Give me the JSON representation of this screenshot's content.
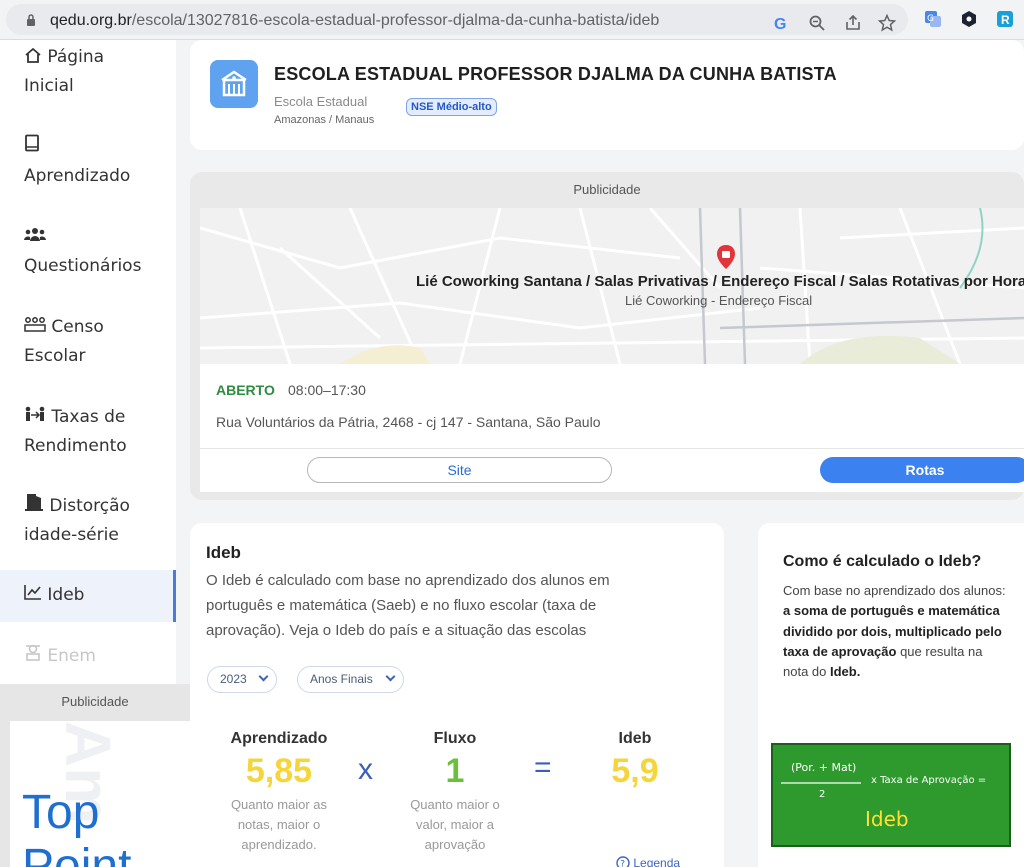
{
  "browser": {
    "url_domain": "qedu.org.br",
    "url_path": "/escola/13027816-escola-estadual-professor-djalma-da-cunha-batista/ideb"
  },
  "sidebar": {
    "items": [
      {
        "icon": "home-icon",
        "label1": "Página",
        "label2": "Inicial"
      },
      {
        "icon": "book-icon",
        "label1": "",
        "label2": " Aprendizado"
      },
      {
        "icon": "people-icon",
        "label1": "",
        "label2": "Questionários"
      },
      {
        "icon": "census-icon",
        "label1": "Censo",
        "label2": "Escolar"
      },
      {
        "icon": "rates-icon",
        "label1": "Taxas de",
        "label2": "Rendimento"
      },
      {
        "icon": "door-icon",
        "label1": "Distorção",
        "label2": "idade-série"
      },
      {
        "icon": "chart-icon",
        "label1": "Ideb",
        "label2": ""
      },
      {
        "icon": "graduation-icon",
        "label1": "Enem",
        "label2": ""
      }
    ],
    "ad_label": "Publicidade",
    "ad_text1": "Top",
    "ad_text2": "Point",
    "ad_ghost": "Am"
  },
  "school": {
    "name": "ESCOLA ESTADUAL PROFESSOR DJALMA DA CUNHA BATISTA",
    "type": "Escola Estadual",
    "location": "Amazonas / Manaus",
    "nse": "NSE Médio-alto"
  },
  "ad": {
    "label": "Publicidade",
    "place_name": "Lié Coworking Santana / Salas Privativas / Endereço Fiscal / Salas Rotativas por Hora",
    "place_sub": "Lié Coworking - Endereço Fiscal",
    "status": "ABERTO",
    "hours": "08:00–17:30",
    "address": "Rua Voluntários da Pátria, 2468 - cj 147 - Santana, São Paulo",
    "site_label": "Site",
    "routes_label": "Rotas"
  },
  "ideb": {
    "title": "Ideb",
    "description": "O Ideb é calculado com base no aprendizado dos alunos em português e matemática (Saeb) e no fluxo escolar (taxa de aprovação). Veja o Ideb do país e a situação das escolas",
    "year": "2023",
    "stage": "Anos Finais",
    "aprendizado_label": "Aprendizado",
    "aprendizado_value": "5,85",
    "aprendizado_note": "Quanto maior as notas, maior o aprendizado.",
    "times": "x",
    "fluxo_label": "Fluxo",
    "fluxo_value": "1",
    "fluxo_note": "Quanto maior o valor, maior a aprovação",
    "equals": "=",
    "ideb_label": "Ideb",
    "ideb_value": "5,9",
    "legend_link": "Legenda",
    "colors": {
      "aprendizado": "#f5d53a",
      "fluxo": "#6bbf3a",
      "ideb": "#f5d53a"
    }
  },
  "how": {
    "title": "Como é calculado o Ideb?",
    "text_plain1": "Com base no aprendizado dos alunos: ",
    "text_bold": "a soma de português e matemática dividido por dois, multiplicado pelo taxa de aprovação",
    "text_plain2": " que resulta na nota do ",
    "text_bold2": "Ideb.",
    "board_numer": "(Por. + Mat)",
    "board_denom": "2",
    "board_times": "x  Taxa de Aprovação  =",
    "board_word": "Ideb"
  }
}
